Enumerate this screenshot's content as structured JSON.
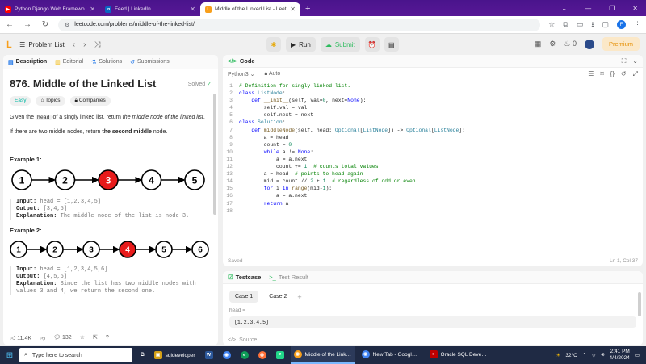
{
  "browser": {
    "tabs": [
      {
        "title": "Python Django Web Framewo",
        "favicon": "youtube-icon",
        "color": "#ff0000"
      },
      {
        "title": "Feed | LinkedIn",
        "favicon": "linkedin-icon",
        "color": "#0a66c2"
      },
      {
        "title": "Middle of the Linked List - Leet",
        "favicon": "leetcode-icon",
        "color": "#f89f1b",
        "active": true
      }
    ],
    "url": "leetcode.com/problems/middle-of-the-linked-list/"
  },
  "lc_header": {
    "problem_list": "Problem List",
    "run": "Run",
    "submit": "Submit",
    "streak": "0",
    "premium": "Premium"
  },
  "left_tabs": [
    "Description",
    "Editorial",
    "Solutions",
    "Submissions"
  ],
  "problem": {
    "title": "876. Middle of the Linked List",
    "solved": "Solved",
    "difficulty": "Easy",
    "topics": "Topics",
    "companies": "Companies",
    "desc_1a": "Given the ",
    "desc_1code": "head",
    "desc_1b": " of a singly linked list, return ",
    "desc_1i": "the middle node of the linked list",
    "desc_1c": ".",
    "desc_2a": "If there are two middle nodes, return ",
    "desc_2b": "the second middle",
    "desc_2c": " node."
  },
  "example1": {
    "label": "Example 1:",
    "nodes": [
      "1",
      "2",
      "3",
      "4",
      "5"
    ],
    "highlight": 2,
    "input_label": "Input:",
    "input": "head = [1,2,3,4,5]",
    "output_label": "Output:",
    "output": "[3,4,5]",
    "expl_label": "Explanation:",
    "explanation": "The middle node of the list is node 3."
  },
  "example2": {
    "label": "Example 2:",
    "nodes": [
      "1",
      "2",
      "3",
      "4",
      "5",
      "6"
    ],
    "highlight": 3,
    "input_label": "Input:",
    "input": "head = [1,2,3,4,5,6]",
    "output_label": "Output:",
    "output": "[4,5,6]",
    "expl_label": "Explanation:",
    "explanation_1": "Since the list has two middle nodes with",
    "explanation_2": "values 3 and 4, we return the second one."
  },
  "left_footer": {
    "likes": "11.4K",
    "comments": "132"
  },
  "code_panel": {
    "title": "Code",
    "language": "Python3",
    "auto": "Auto",
    "saved": "Saved",
    "cursor": "Ln 1, Col 37"
  },
  "code_lines": [
    "# Definition for singly-linked list.",
    "class ListNode:",
    "    def __init__(self, val=0, next=None):",
    "        self.val = val",
    "        self.next = next",
    "class Solution:",
    "    def middleNode(self, head: Optional[ListNode]) -> Optional[ListNode]:",
    "        a = head",
    "        count = 0",
    "        while a != None:",
    "            a = a.next",
    "            count += 1  # counts total values",
    "        a = head  # points to head again",
    "        mid = count // 2 + 1  # regardless of odd or even",
    "        for i in range(mid-1):",
    "            a = a.next",
    "        return a",
    ""
  ],
  "testcase": {
    "tab": "Testcase",
    "result_tab": "Test Result",
    "case1": "Case 1",
    "case2": "Case 2",
    "head_label": "head =",
    "head_value": "[1,2,3,4,5]",
    "source": "Source"
  },
  "taskbar": {
    "search_placeholder": "Type here to search",
    "apps": [
      {
        "label": "sqldeveloper",
        "color": "#d4a017"
      },
      {
        "label": "Middle of the Linke...",
        "color": "#f89f1b"
      },
      {
        "label": "New Tab - Google ...",
        "color": "#4285f4"
      },
      {
        "label": "Oracle SQL Develo...",
        "color": "#c00000"
      }
    ],
    "weather": "32°C",
    "time": "2:41 PM",
    "date": "4/4/2024"
  }
}
